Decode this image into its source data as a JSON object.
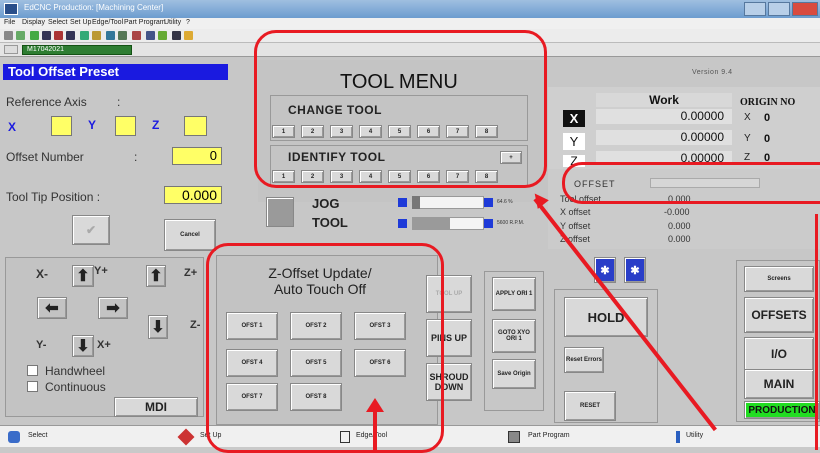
{
  "window": {
    "title": "EdCNC Production: [Machining Center]",
    "menu": [
      "File",
      "Display",
      "Select",
      "Set Up",
      "Edge/Tool",
      "Part Program",
      "Utility",
      "?"
    ],
    "program_combo": "M17042021"
  },
  "tool_offset": {
    "header": "Tool Offset Preset",
    "reference_axis_label": "Reference Axis",
    "axis_x": "X",
    "axis_y": "Y",
    "axis_z": "Z",
    "offset_number_label": "Offset Number",
    "offset_number_value": "0",
    "tool_tip_label": "Tool Tip Position :",
    "tool_tip_value": "0.000",
    "cancel_label": "Cancel"
  },
  "tool_menu": {
    "title": "TOOL MENU",
    "change_tool_label": "CHANGE TOOL",
    "change_buttons": [
      "1",
      "2",
      "3",
      "4",
      "5",
      "6",
      "7",
      "8"
    ],
    "identify_tool_label": "IDENTIFY TOOL",
    "identify_buttons": [
      "1",
      "2",
      "3",
      "4",
      "5",
      "6",
      "7",
      "8"
    ]
  },
  "jog": {
    "jog_label": "JOG",
    "tool_label": "TOOL",
    "jog_percent": "64.6 %",
    "tool_readout": "5600 R.P.M."
  },
  "version_text": "Version 9.4",
  "work": {
    "header": "Work",
    "origin_header": "ORIGIN NO",
    "rows": [
      {
        "axis": "X",
        "value": "0.00000",
        "origin_axis": "X",
        "origin_value": "0"
      },
      {
        "axis": "Y",
        "value": "0.00000",
        "origin_axis": "Y",
        "origin_value": "0"
      },
      {
        "axis": "Z",
        "value": "0.00000",
        "origin_axis": "Z",
        "origin_value": "0"
      }
    ]
  },
  "offset": {
    "header": "OFFSET",
    "rows": [
      {
        "label": "Tool offset",
        "value": "0.000"
      },
      {
        "label": "X offset",
        "value": "-0.000"
      },
      {
        "label": "Y offset",
        "value": "0.000"
      },
      {
        "label": "Z offset",
        "value": "0.000"
      }
    ]
  },
  "jog_pad": {
    "xminus": "X-",
    "yplus": "Y+",
    "zplus": "Z+",
    "yminus": "Y-",
    "xplus": "X+",
    "zminus": "Z-",
    "handwheel_label": "Handwheel",
    "continuous_label": "Continuous",
    "mdi_label": "MDI"
  },
  "zoffset": {
    "title_line1": "Z-Offset Update/",
    "title_line2": "Auto Touch Off",
    "buttons": [
      "OFST 1",
      "OFST 2",
      "OFST 3",
      "OFST 4",
      "OFST 5",
      "OFST 6",
      "OFST 7",
      "OFST 8"
    ]
  },
  "spindle": {
    "tool_up": "TOOL UP",
    "pins_up": "PINS UP",
    "shroud_down": "SHROUD DOWN"
  },
  "origins": {
    "apply": "APPLY ORI 1",
    "goto": "GOTO XYO ORI 1",
    "save": "Save Origin"
  },
  "control": {
    "hold": "HOLD",
    "reset_errors": "Reset Errors",
    "reset": "RESET"
  },
  "screens": {
    "header": "Screens",
    "offsets": "OFFSETS",
    "io": "I/O",
    "main": "MAIN",
    "production": "PRODUCTION"
  },
  "statusbar": {
    "select": "Select",
    "setup": "Set Up",
    "edge_tool": "Edge/Tool",
    "part_program": "Part Program",
    "utility": "Utility"
  },
  "colors": {
    "annotation_red": "#e81a22",
    "header_blue": "#1a1ae0",
    "value_yellow": "#ffff66",
    "production_green": "#22dd22"
  }
}
